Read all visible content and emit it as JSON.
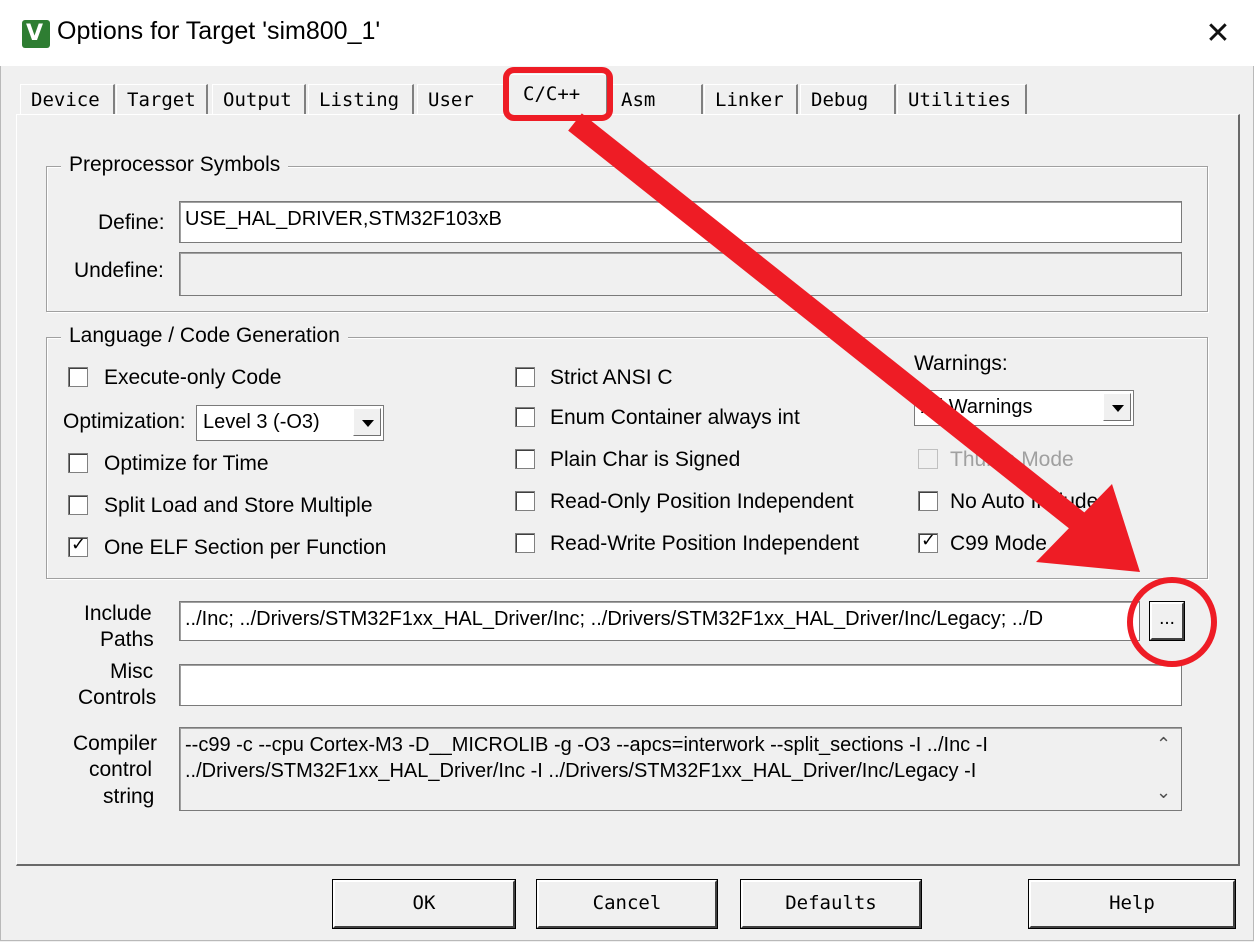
{
  "window": {
    "title": "Options for Target 'sim800_1'",
    "app_icon_glyph": "V",
    "close_glyph": "✕"
  },
  "tabs": [
    "Device",
    "Target",
    "Output",
    "Listing",
    "User",
    "C/C++",
    "Asm",
    "Linker",
    "Debug",
    "Utilities"
  ],
  "active_tab": "C/C++",
  "preprocessor": {
    "legend": "Preprocessor Symbols",
    "define_label": "Define:",
    "define_value": "USE_HAL_DRIVER,STM32F103xB",
    "undefine_label": "Undefine:",
    "undefine_value": ""
  },
  "language": {
    "legend": "Language / Code Generation",
    "execute_only": {
      "label": "Execute-only Code",
      "checked": false
    },
    "optimization_label": "Optimization:",
    "optimization_value": "Level 3 (-O3)",
    "optimize_time": {
      "label": "Optimize for Time",
      "checked": false
    },
    "split_load": {
      "label": "Split Load and Store Multiple",
      "checked": false
    },
    "one_elf": {
      "label": "One ELF Section per Function",
      "checked": true
    },
    "strict_ansi": {
      "label": "Strict ANSI C",
      "checked": false
    },
    "enum_container": {
      "label": "Enum Container always int",
      "checked": false
    },
    "plain_char": {
      "label": "Plain Char is Signed",
      "checked": false
    },
    "ro_pos_indep": {
      "label": "Read-Only Position Independent",
      "checked": false
    },
    "rw_pos_indep": {
      "label": "Read-Write Position Independent",
      "checked": false
    },
    "warnings_label": "Warnings:",
    "warnings_value": "All Warnings",
    "thumb_mode": {
      "label": "Thumb Mode",
      "checked": false,
      "enabled": false
    },
    "no_auto_includes": {
      "label": "No Auto Includes",
      "checked": false
    },
    "c99_mode": {
      "label": "C99 Mode",
      "checked": true
    }
  },
  "include_paths": {
    "label_line1": "Include",
    "label_line2": "Paths",
    "value": "../Inc; ../Drivers/STM32F1xx_HAL_Driver/Inc; ../Drivers/STM32F1xx_HAL_Driver/Inc/Legacy; ../D",
    "browse_label": "..."
  },
  "misc_controls": {
    "label_line1": "Misc",
    "label_line2": "Controls",
    "value": ""
  },
  "compiler_string": {
    "label_line1": "Compiler",
    "label_line2": "control",
    "label_line3": "string",
    "line1": "--c99 -c --cpu Cortex-M3 -D__MICROLIB -g -O3 --apcs=interwork --split_sections -I ../Inc -I",
    "line2": "../Drivers/STM32F1xx_HAL_Driver/Inc -I ../Drivers/STM32F1xx_HAL_Driver/Inc/Legacy -I"
  },
  "buttons": {
    "ok": "OK",
    "cancel": "Cancel",
    "defaults": "Defaults",
    "help": "Help"
  },
  "colors": {
    "annotation_red": "#ee1c25",
    "dialog_bg": "#f0f0f0",
    "icon_green": "#2e7d32"
  }
}
